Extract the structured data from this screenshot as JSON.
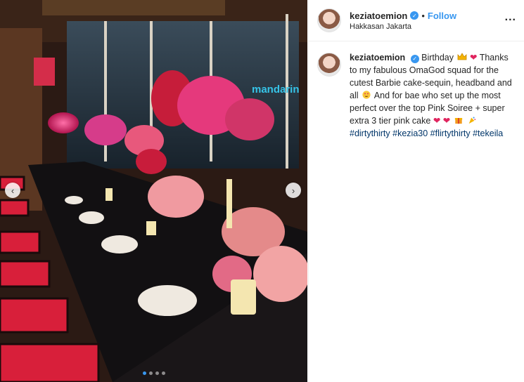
{
  "post": {
    "username": "keziatoemion",
    "follow_label": "Follow",
    "separator": "•",
    "location": "Hakkasan Jakarta",
    "more_label": "...",
    "caption_parts": {
      "p1": "Birthday",
      "p2": "Thanks to my fabulous OmaGod squad for the cutest Barbie cake-sequin, headband and all",
      "p3": "And for bae who set up the most perfect over the top Pink Soiree + super extra 3 tier pink cake"
    },
    "hashtags": [
      "#dirtythirty",
      "#kezia30",
      "#flirtythirty",
      "#tekeila"
    ]
  },
  "carousel": {
    "prev_icon": "‹",
    "next_icon": "›",
    "dots": 4,
    "active_dot": 1
  },
  "colors": {
    "accent": "#3897f0",
    "hashtag": "#003569",
    "sign": "mandarin"
  },
  "icons": [
    "verified-badge-icon",
    "crown-icon",
    "heart-icon",
    "heart-eyes-icon",
    "gift-icon",
    "party-popper-icon"
  ]
}
